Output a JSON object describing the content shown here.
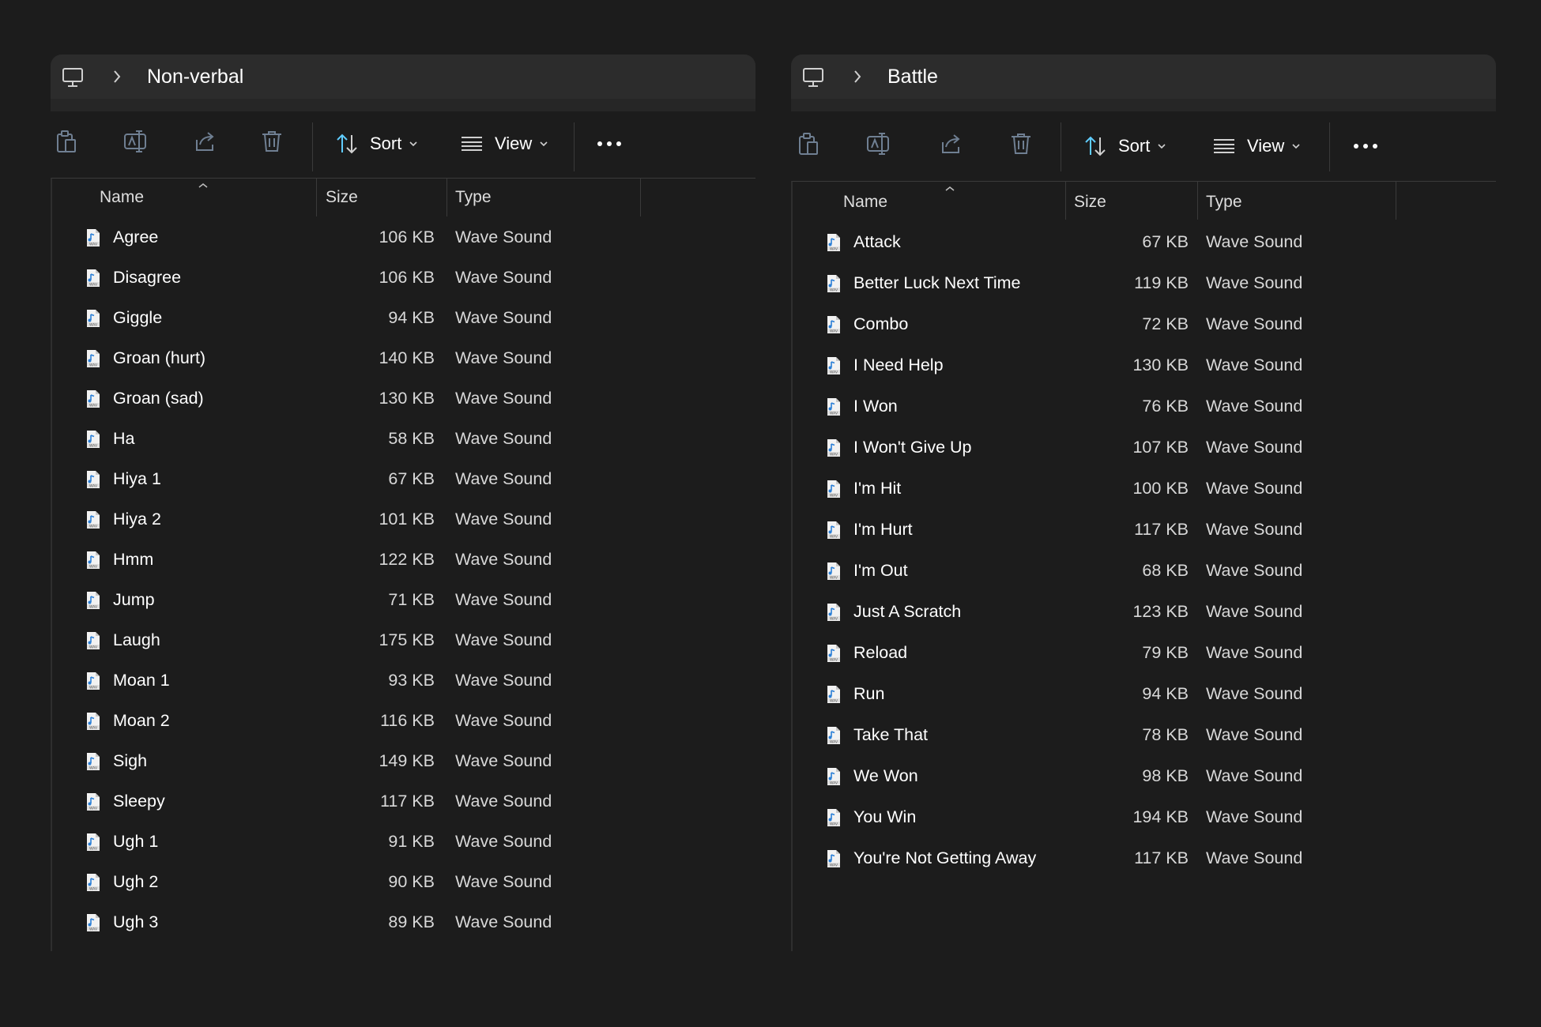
{
  "windows": [
    {
      "breadcrumb": "Non-verbal",
      "toolbar": {
        "sort_label": "Sort",
        "view_label": "View",
        "more_label": "•••"
      },
      "columns": {
        "name": "Name",
        "size": "Size",
        "type": "Type"
      },
      "files": [
        {
          "name": "Agree",
          "size": "106 KB",
          "type": "Wave Sound"
        },
        {
          "name": "Disagree",
          "size": "106 KB",
          "type": "Wave Sound"
        },
        {
          "name": "Giggle",
          "size": "94 KB",
          "type": "Wave Sound"
        },
        {
          "name": "Groan (hurt)",
          "size": "140 KB",
          "type": "Wave Sound"
        },
        {
          "name": "Groan (sad)",
          "size": "130 KB",
          "type": "Wave Sound"
        },
        {
          "name": "Ha",
          "size": "58 KB",
          "type": "Wave Sound"
        },
        {
          "name": "Hiya 1",
          "size": "67 KB",
          "type": "Wave Sound"
        },
        {
          "name": "Hiya 2",
          "size": "101 KB",
          "type": "Wave Sound"
        },
        {
          "name": "Hmm",
          "size": "122 KB",
          "type": "Wave Sound"
        },
        {
          "name": "Jump",
          "size": "71 KB",
          "type": "Wave Sound"
        },
        {
          "name": "Laugh",
          "size": "175 KB",
          "type": "Wave Sound"
        },
        {
          "name": "Moan 1",
          "size": "93 KB",
          "type": "Wave Sound"
        },
        {
          "name": "Moan 2",
          "size": "116 KB",
          "type": "Wave Sound"
        },
        {
          "name": "Sigh",
          "size": "149 KB",
          "type": "Wave Sound"
        },
        {
          "name": "Sleepy",
          "size": "117 KB",
          "type": "Wave Sound"
        },
        {
          "name": "Ugh 1",
          "size": "91 KB",
          "type": "Wave Sound"
        },
        {
          "name": "Ugh 2",
          "size": "90 KB",
          "type": "Wave Sound"
        },
        {
          "name": "Ugh 3",
          "size": "89 KB",
          "type": "Wave Sound"
        }
      ]
    },
    {
      "breadcrumb": "Battle",
      "toolbar": {
        "sort_label": "Sort",
        "view_label": "View",
        "more_label": "•••"
      },
      "columns": {
        "name": "Name",
        "size": "Size",
        "type": "Type"
      },
      "files": [
        {
          "name": "Attack",
          "size": "67 KB",
          "type": "Wave Sound"
        },
        {
          "name": "Better Luck Next Time",
          "size": "119 KB",
          "type": "Wave Sound"
        },
        {
          "name": "Combo",
          "size": "72 KB",
          "type": "Wave Sound"
        },
        {
          "name": "I Need Help",
          "size": "130 KB",
          "type": "Wave Sound"
        },
        {
          "name": "I Won",
          "size": "76 KB",
          "type": "Wave Sound"
        },
        {
          "name": "I Won't Give Up",
          "size": "107 KB",
          "type": "Wave Sound"
        },
        {
          "name": "I'm Hit",
          "size": "100 KB",
          "type": "Wave Sound"
        },
        {
          "name": "I'm Hurt",
          "size": "117 KB",
          "type": "Wave Sound"
        },
        {
          "name": "I'm Out",
          "size": "68 KB",
          "type": "Wave Sound"
        },
        {
          "name": "Just A Scratch",
          "size": "123 KB",
          "type": "Wave Sound"
        },
        {
          "name": "Reload",
          "size": "79 KB",
          "type": "Wave Sound"
        },
        {
          "name": "Run",
          "size": "94 KB",
          "type": "Wave Sound"
        },
        {
          "name": "Take That",
          "size": "78 KB",
          "type": "Wave Sound"
        },
        {
          "name": "We Won",
          "size": "98 KB",
          "type": "Wave Sound"
        },
        {
          "name": "You Win",
          "size": "194 KB",
          "type": "Wave Sound"
        },
        {
          "name": "You're Not Getting Away",
          "size": "117 KB",
          "type": "Wave Sound"
        }
      ]
    }
  ],
  "icons": {
    "address": [
      "computer-icon",
      "chevron-right-icon"
    ],
    "toolbar": [
      "copy-icon",
      "rename-icon",
      "share-icon",
      "delete-icon",
      "sort-arrows-icon",
      "view-lines-icon",
      "chevron-down-icon",
      "more-icon"
    ],
    "file": "wave-file-icon",
    "header": "sort-caret-up-icon"
  },
  "colors": {
    "background": "#1c1c1c",
    "address_bar": "#2c2c2c",
    "text": "#ffffff",
    "muted_icon": "#6f7f92",
    "accent": "#60cdff"
  }
}
